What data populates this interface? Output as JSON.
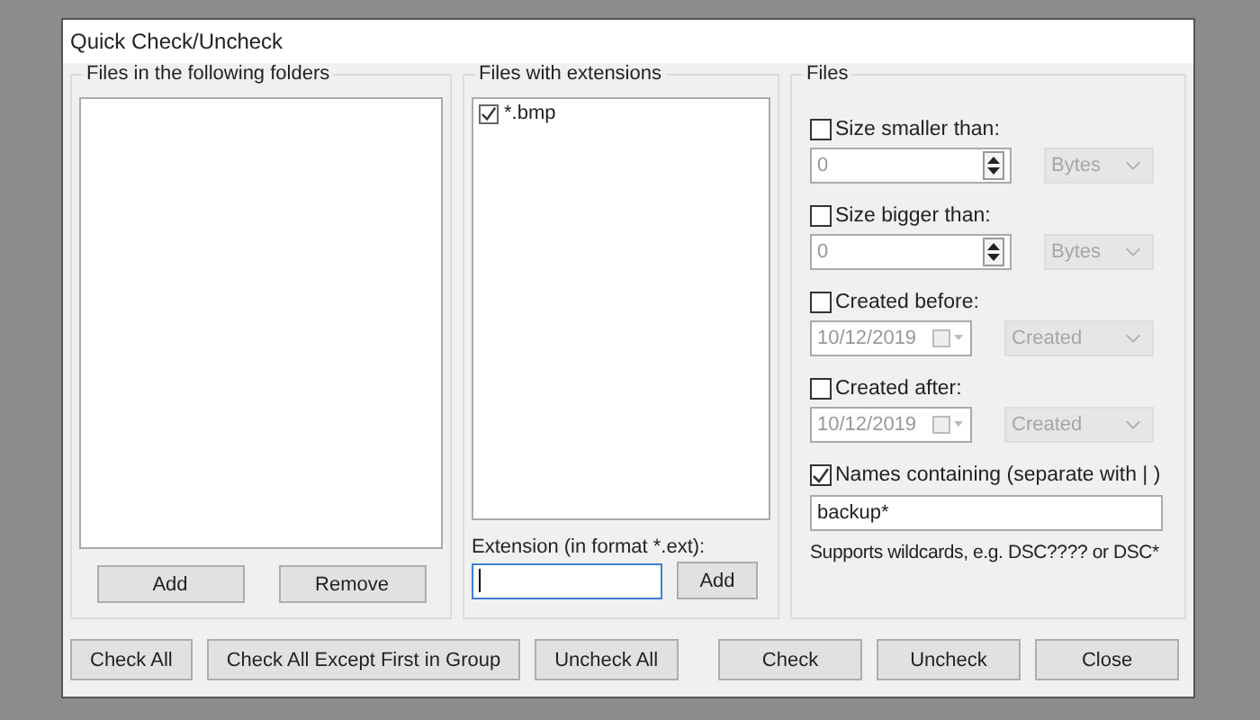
{
  "window": {
    "title": "Quick Check/Uncheck"
  },
  "folders": {
    "title": "Files in the following folders",
    "buttons": [
      "Add",
      "Remove"
    ]
  },
  "extensions": {
    "title": "Files with extensions",
    "items": [
      {
        "label": "*.bmp",
        "checked": true
      }
    ],
    "field": {
      "label": "Extension (in format *.ext):",
      "focused": true
    },
    "button": "Add"
  },
  "files": {
    "title": "Files",
    "filters": [
      {
        "kind": "number",
        "label": "Size smaller than:",
        "checked": false,
        "value": "0",
        "unit": "Bytes"
      },
      {
        "kind": "number",
        "label": "Size bigger than:",
        "checked": false,
        "value": "0",
        "unit": "Bytes"
      },
      {
        "kind": "date",
        "label": "Created before:",
        "checked": false,
        "value": "10/12/2019",
        "unit": "Created"
      },
      {
        "kind": "date",
        "label": "Created after:",
        "checked": false,
        "value": "10/12/2019",
        "unit": "Created"
      },
      {
        "kind": "text",
        "label": "Names containing (separate with | )",
        "checked": true,
        "value": "backup*",
        "note": "Supports wildcards, e.g. DSC???? or DSC*"
      }
    ]
  },
  "footer": {
    "left": [
      "Check All",
      "Check All Except First in Group",
      "Uncheck All"
    ],
    "right": [
      "Check",
      "Uncheck",
      "Close"
    ]
  }
}
